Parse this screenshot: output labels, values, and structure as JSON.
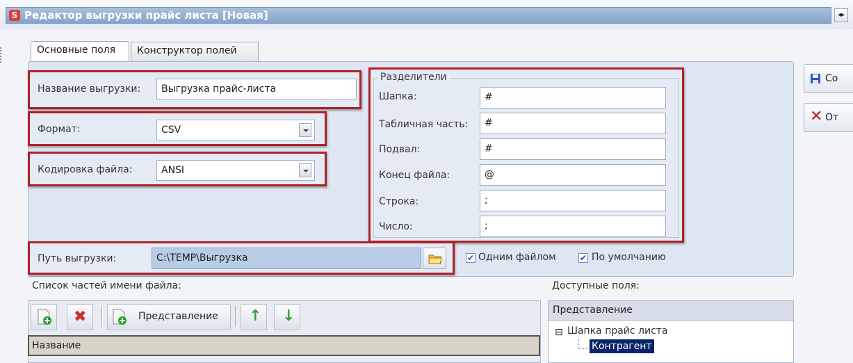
{
  "window": {
    "title": "Редактор выгрузки прайс листа [Новая]",
    "app_icon_glyph": "S"
  },
  "tabs": [
    {
      "label": "Основные поля",
      "active": true
    },
    {
      "label": "Конструктор полей",
      "active": false
    }
  ],
  "form": {
    "name_label": "Название выгрузки:",
    "name_value": "Выгрузка прайс-листа",
    "format_label": "Формат:",
    "format_value": "CSV",
    "encoding_label": "Кодировка файла:",
    "encoding_value": "ANSI",
    "path_label": "Путь выгрузки:",
    "path_value": "C:\\TEMP\\Выгрузка",
    "one_file_label": "Одним файлом",
    "one_file_checked": true,
    "default_label": "По умолчанию",
    "default_checked": true
  },
  "separators": {
    "legend": "Разделители",
    "rows": [
      {
        "label": "Шапка:",
        "value": "#"
      },
      {
        "label": "Табличная часть:",
        "value": "#"
      },
      {
        "label": "Подвал:",
        "value": "#"
      },
      {
        "label": "Конец файла:",
        "value": "@"
      },
      {
        "label": "Строка:",
        "value": ";"
      },
      {
        "label": "Число:",
        "value": ";"
      }
    ]
  },
  "side_buttons": {
    "save_label": "Со",
    "cancel_label": "От"
  },
  "filename_parts": {
    "title": "Список частей имени файла:",
    "toolbar_repr_label": "Представление",
    "column_header": "Название"
  },
  "available_fields": {
    "title": "Доступные поля:",
    "header": "Представление",
    "tree_root": "Шапка прайс листа",
    "tree_child": "Контрагент",
    "expander_glyph": "⊟"
  },
  "colors": {
    "highlight_border": "#b12028",
    "selection_bg": "#0a246a",
    "path_field_bg": "#b9cce6"
  }
}
